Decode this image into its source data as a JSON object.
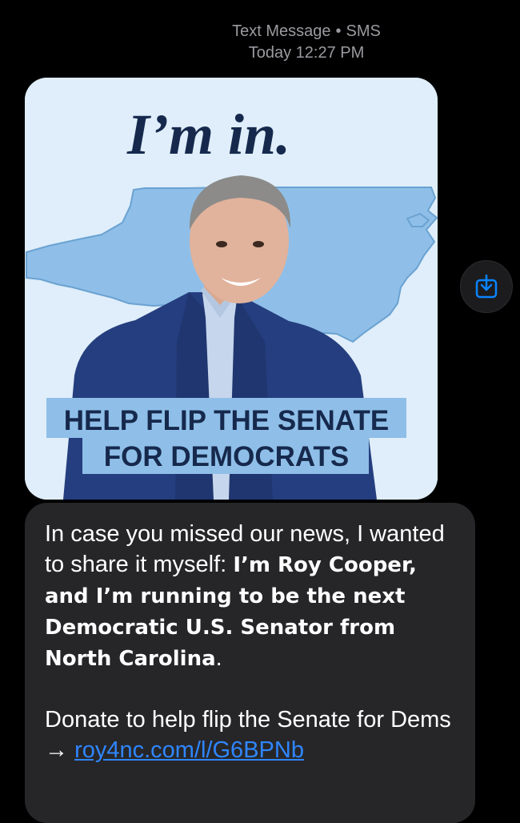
{
  "header": {
    "service": "Text Message",
    "separator": "•",
    "protocol": "SMS",
    "timestamp": "Today 12:27 PM"
  },
  "image": {
    "headline": "I’m in.",
    "banner_line1": "HELP FLIP THE SENATE",
    "banner_line2": "FOR DEMOCRATS",
    "colors": {
      "background": "#dfeefa",
      "map": "#8fbfe8",
      "headline": "#16294d",
      "banner": "#8fbfe8",
      "banner_text": "#16294d"
    }
  },
  "share_button": {
    "icon": "share-download-icon"
  },
  "message": {
    "intro": "In case you missed our news, I wanted to share it myself: ",
    "bold": "I’m Roy Cooper, and I’m running to be the next Democratic U.S. Senator from North Carolina",
    "period": ".",
    "donate_text": "Donate to help flip the Senate for Dems → ",
    "link_text": "roy4nc.com/l/G6BPNb"
  }
}
